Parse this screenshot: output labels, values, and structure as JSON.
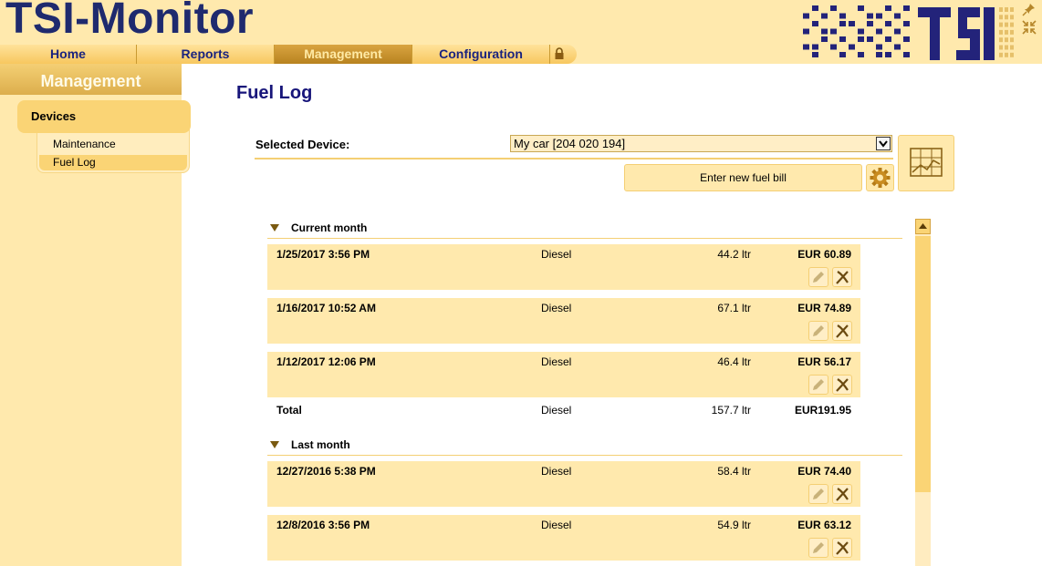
{
  "app": {
    "title": "TSI-Monitor",
    "logo_text": "TSI"
  },
  "topnav": [
    {
      "label": "Home"
    },
    {
      "label": "Reports"
    },
    {
      "label": "Management",
      "active": true
    },
    {
      "label": "Configuration"
    }
  ],
  "icons": {
    "lock": "lock-icon",
    "pin": "pin-icon",
    "collapse": "collapse-icon",
    "gear": "gear-icon",
    "chart": "chart-icon",
    "edit": "pencil-icon",
    "delete": "delete-icon"
  },
  "sidebar": {
    "title": "Management",
    "section": "Devices",
    "items": [
      {
        "label": "Maintenance"
      },
      {
        "label": "Fuel Log",
        "selected": true
      }
    ]
  },
  "main": {
    "title": "Fuel Log",
    "device_label": "Selected Device:",
    "device_value": "My car [204 020 194]",
    "new_bill_label": "Enter new fuel bill"
  },
  "groups": [
    {
      "title": "Current month",
      "entries": [
        {
          "date": "1/25/2017 3:56 PM",
          "fuel": "Diesel",
          "volume": "44.2 ltr",
          "amount": "EUR 60.89"
        },
        {
          "date": "1/16/2017 10:52 AM",
          "fuel": "Diesel",
          "volume": "67.1 ltr",
          "amount": "EUR 74.89"
        },
        {
          "date": "1/12/2017 12:06 PM",
          "fuel": "Diesel",
          "volume": "46.4 ltr",
          "amount": "EUR 56.17"
        }
      ],
      "total": {
        "label": "Total",
        "fuel": "Diesel",
        "volume": "157.7 ltr",
        "amount": "EUR191.95"
      }
    },
    {
      "title": "Last month",
      "entries": [
        {
          "date": "12/27/2016 5:38 PM",
          "fuel": "Diesel",
          "volume": "58.4 ltr",
          "amount": "EUR 74.40"
        },
        {
          "date": "12/8/2016 3:56 PM",
          "fuel": "Diesel",
          "volume": "54.9 ltr",
          "amount": "EUR 63.12"
        }
      ]
    }
  ],
  "colors": {
    "title_blue": "#17157a",
    "nav_blue": "#1a237e",
    "header_bg": "#ffe9ad",
    "accent_gold": "#f4cf74",
    "logo_navy": "#23237a"
  }
}
